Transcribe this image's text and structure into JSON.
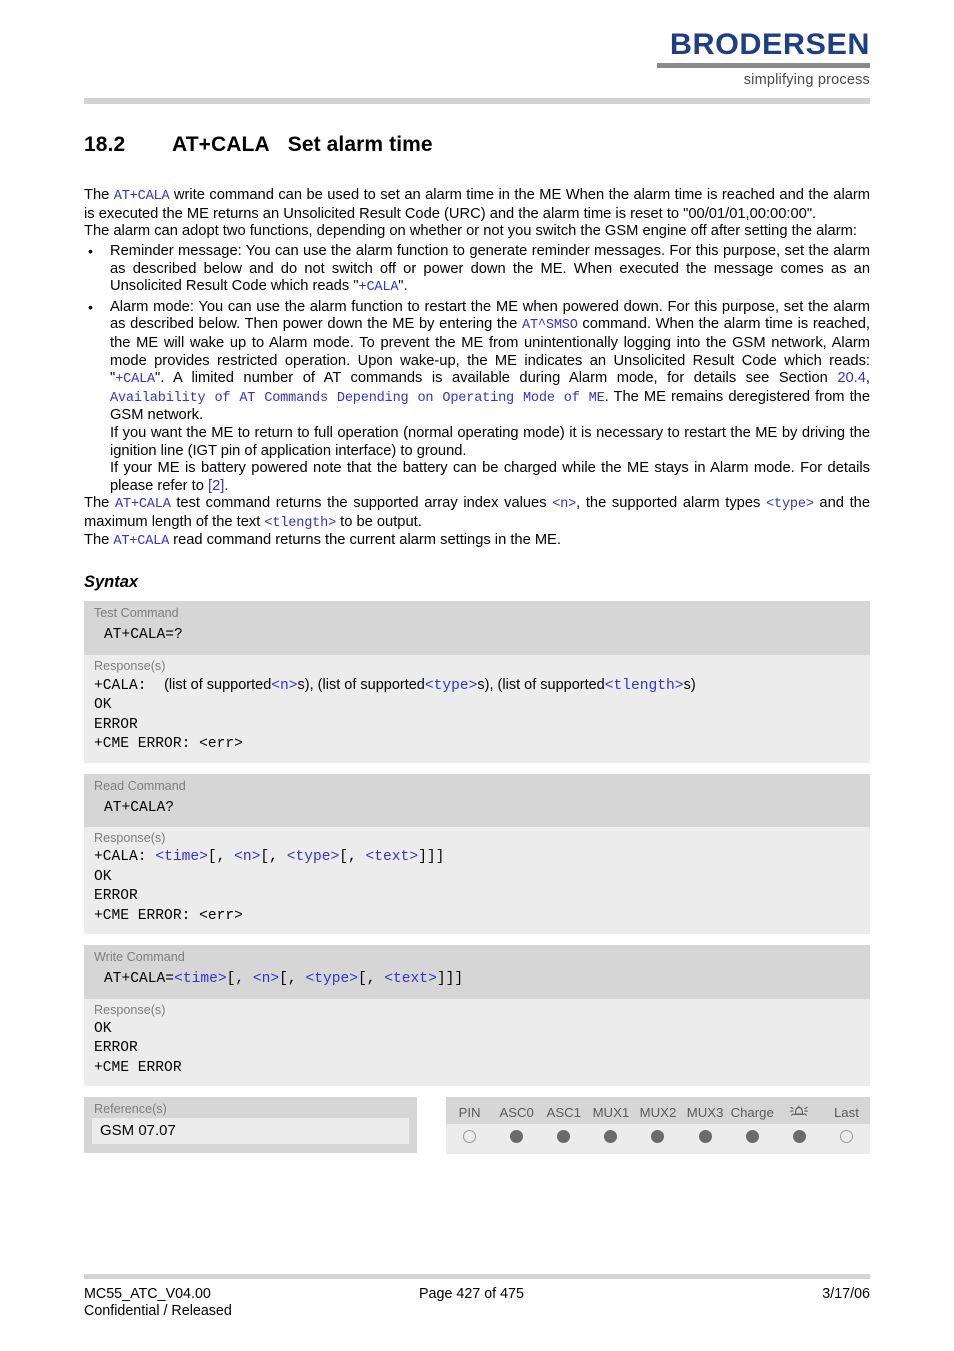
{
  "header": {
    "logo_word": "BRODERSEN",
    "logo_tagline": "simplifying process"
  },
  "title": {
    "number": "18.2",
    "command": "AT+CALA",
    "description": "Set alarm time"
  },
  "intro": {
    "p1_a": "The ",
    "p1_code": "AT+CALA",
    "p1_b": " write command can be used to set an alarm time in the ME When the alarm time is reached and the alarm is executed the ME returns an Unsolicited Result Code (URC) and the alarm time is reset to \"00/01/01,00:00:00\".",
    "p2": "The alarm can adopt two functions, depending on whether or not you switch the GSM engine off after setting the alarm:"
  },
  "bullets": [
    {
      "text_a": "Reminder message: You can use the alarm function to generate reminder messages. For this purpose, set the alarm as described below and do not switch off or power down the ME. When executed the message comes as an Unsolicited Result Code which reads \"",
      "code_1": "+CALA",
      "text_b": "\"."
    },
    {
      "text_a": "Alarm mode: You can use the alarm function to restart the ME when powered down. For this purpose, set the alarm as described below. Then power down the ME by entering the ",
      "code_1": "AT^SMSO",
      "text_b": " command. When the alarm time is reached, the ME will wake up to Alarm mode. To prevent the ME from unintentionally logging into the GSM network, Alarm mode provides restricted operation. Upon wake-up, the ME indicates an Unsolicited Result Code which reads: \"",
      "code_2": "+CALA",
      "text_c": "\". A limited number of AT commands is available during Alarm mode, for details see Section ",
      "xref_num": "20.4",
      "text_d": ", ",
      "xref_title": "Availability of AT Commands Depending on Operating Mode of ME",
      "text_e": ". The ME remains deregistered from the GSM network.",
      "sub_1": "If you want the ME to return to full operation (normal operating mode) it is necessary to restart the ME by driving the ignition line (IGT pin of application interface) to ground.",
      "sub_2_a": "If your ME is battery powered note that the battery can be charged while the ME stays in Alarm mode. For details please refer to ",
      "sub_2_ref": "[2]",
      "sub_2_b": "."
    }
  ],
  "outro": {
    "p1_a": "The ",
    "p1_code": "AT+CALA",
    "p1_b": " test command returns the supported array index values ",
    "p1_n": "<n>",
    "p1_c": ", the supported alarm types ",
    "p1_type": "<type>",
    "p1_d": " and the maximum length of the text ",
    "p1_tlength": "<tlength>",
    "p1_e": " to be output.",
    "p2_a": "The ",
    "p2_code": "AT+CALA",
    "p2_b": " read command returns the current alarm settings in the ME."
  },
  "syntax": {
    "heading": "Syntax",
    "blocks": [
      {
        "cmd_label": "Test Command",
        "cmd_line": "AT+CALA=?",
        "resp_label": "Response(s)",
        "resp_prefix": "+CALA:",
        "resp_list_1": "(list of supported",
        "resp_n": "<n>",
        "resp_list_2": "s), (list of supported",
        "resp_type": "<type>",
        "resp_list_3": "s), (list of supported",
        "resp_tlength": "<tlength>",
        "resp_list_4": "s)",
        "resp_ok": "OK",
        "resp_error": "ERROR",
        "resp_cme": "+CME ERROR: <err>"
      },
      {
        "cmd_label": "Read Command",
        "cmd_line": "AT+CALA?",
        "resp_label": "Response(s)",
        "resp_prefix": "+CALA:",
        "resp_time": "<time>",
        "resp_sep1": "[, ",
        "resp_n": "<n>",
        "resp_sep2": "[, ",
        "resp_type": "<type>",
        "resp_sep3": "[, ",
        "resp_text": "<text>",
        "resp_close": "]]]",
        "resp_ok": "OK",
        "resp_error": "ERROR",
        "resp_cme": "+CME ERROR: <err>"
      },
      {
        "cmd_label": "Write Command",
        "cmd_prefix": "AT+CALA=",
        "cmd_time": "<time>",
        "cmd_sep1": "[, ",
        "cmd_n": "<n>",
        "cmd_sep2": "[, ",
        "cmd_type": "<type>",
        "cmd_sep3": "[, ",
        "cmd_text": "<text>",
        "cmd_close": "]]]",
        "resp_label": "Response(s)",
        "resp_ok": "OK",
        "resp_error": "ERROR",
        "resp_cme": "+CME ERROR"
      }
    ]
  },
  "reference": {
    "label": "Reference(s)",
    "value": "GSM 07.07"
  },
  "indicators": {
    "columns": [
      "PIN",
      "ASC0",
      "ASC1",
      "MUX1",
      "MUX2",
      "MUX3",
      "Charge",
      "alarm-bell-icon",
      "Last"
    ],
    "states": [
      "empty",
      "filled",
      "filled",
      "filled",
      "filled",
      "filled",
      "filled",
      "filled",
      "empty"
    ]
  },
  "footer": {
    "left_line1": "MC55_ATC_V04.00",
    "left_line2": "Confidential / Released",
    "center": "Page 427 of 475",
    "right": "3/17/06"
  },
  "colors": {
    "code_blue": "#3333cc",
    "logo_blue": "#1f3f82",
    "band_dark": "#d6d6d6",
    "band_light": "#ececec",
    "rule_gray": "#d2d3d5"
  }
}
